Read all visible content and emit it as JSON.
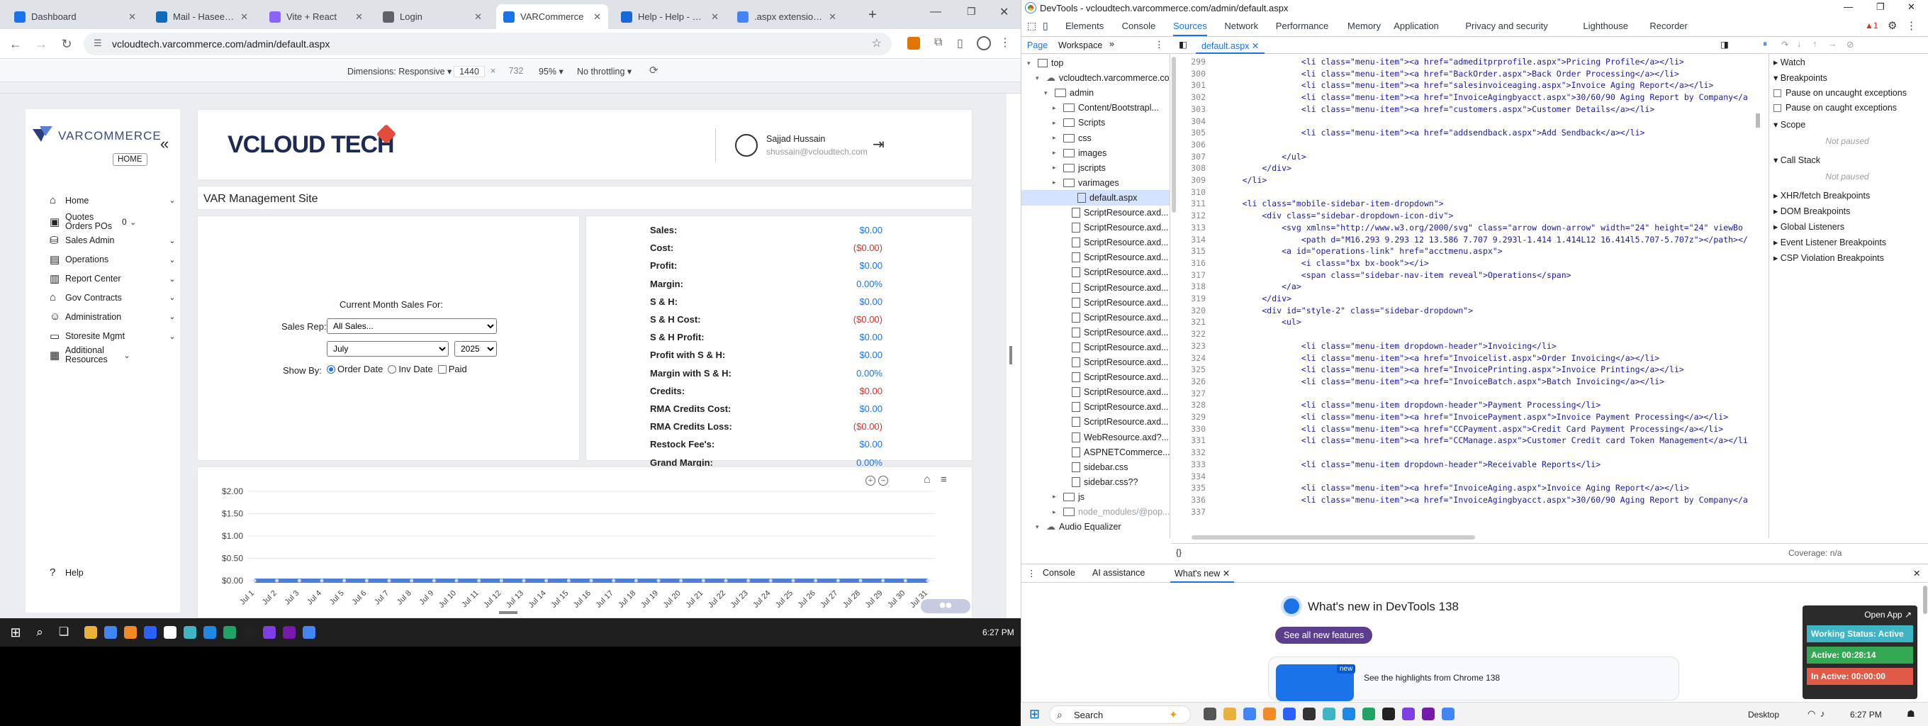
{
  "browser": {
    "tabs": [
      {
        "title": "Dashboard",
        "color": "#1a73e8"
      },
      {
        "title": "Mail - Haseeb Sha",
        "color": "#0f6cbd"
      },
      {
        "title": "Vite + React",
        "color": "#8a63ff"
      },
      {
        "title": "Login",
        "color": "#5f6368"
      },
      {
        "title": "VARCommerce",
        "color": "#1a73e8"
      },
      {
        "title": "Help - Help - Corr",
        "color": "#1868db"
      },
      {
        "title": ".aspx extension - G",
        "color": "#4285f4"
      }
    ],
    "url": "vcloudtech.varcommerce.com/admin/default.aspx",
    "device_toolbar": {
      "dimensions_label": "Dimensions: Responsive",
      "width": "1440",
      "height": "732",
      "zoom": "95%",
      "throttling": "No throttling"
    }
  },
  "site": {
    "home_button": "HOME",
    "user_name": "Sajjad Hussain",
    "user_email": "shussain@vcloudtech.com",
    "page_title": "VAR Management Site",
    "nav": [
      {
        "label": "Home",
        "icon": "home-icon",
        "glyph": "⌂"
      },
      {
        "label": "Quotes Orders POs",
        "icon": "quotes-icon",
        "glyph": "▣",
        "badge": "0"
      },
      {
        "label": "Sales Admin",
        "icon": "sales-admin-icon",
        "glyph": "⛁"
      },
      {
        "label": "Operations",
        "icon": "operations-icon",
        "glyph": "▤"
      },
      {
        "label": "Report Center",
        "icon": "report-center-icon",
        "glyph": "▥"
      },
      {
        "label": "Gov Contracts",
        "icon": "gov-contracts-icon",
        "glyph": "⌂"
      },
      {
        "label": "Administration",
        "icon": "administration-icon",
        "glyph": "☺"
      },
      {
        "label": "Storesite Mgmt",
        "icon": "storesite-icon",
        "glyph": "▭"
      },
      {
        "label": "Additional Resources",
        "icon": "resources-icon",
        "glyph": "▦"
      }
    ],
    "help_label": "Help",
    "filters": {
      "heading": "Current Month Sales For:",
      "sales_rep_label": "Sales Rep:",
      "sales_rep_value": "All Sales...",
      "month": "July",
      "year": "2025",
      "show_by_label": "Show By:",
      "opt_order_date": "Order Date",
      "opt_inv_date": "Inv Date",
      "opt_paid": "Paid"
    },
    "summary": [
      {
        "label": "Sales:",
        "value": "$0.00",
        "color": "#1a73e8"
      },
      {
        "label": "Cost:",
        "value": "($0.00)",
        "color": "#d93025"
      },
      {
        "label": "Profit:",
        "value": "$0.00",
        "color": "#1a73e8"
      },
      {
        "label": "Margin:",
        "value": "0.00%",
        "color": "#1a73e8"
      },
      {
        "label": "S & H:",
        "value": "$0.00",
        "color": "#1a73e8"
      },
      {
        "label": "S & H Cost:",
        "value": "($0.00)",
        "color": "#d93025"
      },
      {
        "label": "S & H Profit:",
        "value": "$0.00",
        "color": "#1a73e8"
      },
      {
        "label": "Profit with S & H:",
        "value": "$0.00",
        "color": "#1a73e8"
      },
      {
        "label": "Margin with S & H:",
        "value": "0.00%",
        "color": "#1a73e8"
      },
      {
        "label": "Credits:",
        "value": "$0.00",
        "color": "#d93025"
      },
      {
        "label": "RMA Credits Cost:",
        "value": "$0.00",
        "color": "#1a73e8"
      },
      {
        "label": "RMA Credits Loss:",
        "value": "($0.00)",
        "color": "#d93025"
      },
      {
        "label": "Restock Fee's:",
        "value": "$0.00",
        "color": "#1a73e8"
      },
      {
        "label": "Grand Margin:",
        "value": "0.00%",
        "color": "#1a73e8"
      },
      {
        "label": "Grand Profit:",
        "value": "$0.00",
        "color": "#188038"
      }
    ]
  },
  "chart_data": {
    "type": "line",
    "categories": [
      "Jul 1",
      "Jul 2",
      "Jul 3",
      "Jul 4",
      "Jul 5",
      "Jul 6",
      "Jul 7",
      "Jul 8",
      "Jul 9",
      "Jul 10",
      "Jul 11",
      "Jul 12",
      "Jul 13",
      "Jul 14",
      "Jul 15",
      "Jul 16",
      "Jul 17",
      "Jul 18",
      "Jul 19",
      "Jul 20",
      "Jul 21",
      "Jul 22",
      "Jul 23",
      "Jul 24",
      "Jul 25",
      "Jul 26",
      "Jul 27",
      "Jul 28",
      "Jul 29",
      "Jul 30",
      "Jul 31"
    ],
    "series": [
      {
        "values": [
          0,
          0,
          0,
          0,
          0,
          0,
          0,
          0,
          0,
          0,
          0,
          0,
          0,
          0,
          0,
          0,
          0,
          0,
          0,
          0,
          0,
          0,
          0,
          0,
          0,
          0,
          0,
          0,
          0,
          0,
          0
        ],
        "color": "#4e7fd6"
      }
    ],
    "y_ticks": [
      "$2.00",
      "$1.50",
      "$1.00",
      "$0.50",
      "$0.00"
    ],
    "ylim": [
      0,
      2
    ],
    "grid": true
  },
  "taskbar_left": {
    "time": "6:27 PM"
  },
  "devtools": {
    "title": "DevTools - vcloudtech.varcommerce.com/admin/default.aspx",
    "tabs": [
      "Elements",
      "Console",
      "Sources",
      "Network",
      "Performance",
      "Memory",
      "Application",
      "Privacy and security",
      "Lighthouse",
      "Recorder"
    ],
    "active_tab": "Sources",
    "issues_count": "1",
    "source_tabs": [
      "Page",
      "Workspace"
    ],
    "open_file": "default.aspx",
    "tree": [
      {
        "label": "top",
        "indent": 1,
        "type": "frame"
      },
      {
        "label": "vcloudtech.varcommerce.com",
        "indent": 2,
        "type": "cloud"
      },
      {
        "label": "admin",
        "indent": 3,
        "type": "folder"
      },
      {
        "label": "Content/Bootstrapl...",
        "indent": 4,
        "type": "folder"
      },
      {
        "label": "Scripts",
        "indent": 4,
        "type": "folder"
      },
      {
        "label": "css",
        "indent": 4,
        "type": "folder"
      },
      {
        "label": "images",
        "indent": 4,
        "type": "folder"
      },
      {
        "label": "jscripts",
        "indent": 4,
        "type": "folder"
      },
      {
        "label": "varimages",
        "indent": 4,
        "type": "folder"
      },
      {
        "label": "default.aspx",
        "indent": 4,
        "type": "file",
        "selected": true
      },
      {
        "label": "ScriptResource.axd...",
        "indent": 5,
        "type": "file"
      },
      {
        "label": "ScriptResource.axd...",
        "indent": 5,
        "type": "file"
      },
      {
        "label": "ScriptResource.axd...",
        "indent": 5,
        "type": "file"
      },
      {
        "label": "ScriptResource.axd...",
        "indent": 5,
        "type": "file"
      },
      {
        "label": "ScriptResource.axd...",
        "indent": 5,
        "type": "file"
      },
      {
        "label": "ScriptResource.axd...",
        "indent": 5,
        "type": "file"
      },
      {
        "label": "ScriptResource.axd...",
        "indent": 5,
        "type": "file"
      },
      {
        "label": "ScriptResource.axd...",
        "indent": 5,
        "type": "file"
      },
      {
        "label": "ScriptResource.axd...",
        "indent": 5,
        "type": "file"
      },
      {
        "label": "ScriptResource.axd...",
        "indent": 5,
        "type": "file"
      },
      {
        "label": "ScriptResource.axd...",
        "indent": 5,
        "type": "file"
      },
      {
        "label": "ScriptResource.axd...",
        "indent": 5,
        "type": "file"
      },
      {
        "label": "ScriptResource.axd...",
        "indent": 5,
        "type": "file"
      },
      {
        "label": "ScriptResource.axd...",
        "indent": 5,
        "type": "file"
      },
      {
        "label": "ScriptResource.axd...",
        "indent": 5,
        "type": "file"
      },
      {
        "label": "WebResource.axd?...",
        "indent": 5,
        "type": "file"
      },
      {
        "label": "ASPNETCommerce...",
        "indent": 5,
        "type": "file"
      },
      {
        "label": "sidebar.css",
        "indent": 5,
        "type": "file"
      },
      {
        "label": "sidebar.css??",
        "indent": 5,
        "type": "file"
      },
      {
        "label": "js",
        "indent": 4,
        "type": "folder"
      },
      {
        "label": "node_modules/@pop...",
        "indent": 4,
        "type": "folder"
      },
      {
        "label": "Audio Equalizer",
        "indent": 2,
        "type": "cloud"
      }
    ],
    "code_lines": [
      {
        "n": "299",
        "t": "                <li class=\"menu-item\"><a href=\"admeditprprofile.aspx\">Pricing Profile</a></li>"
      },
      {
        "n": "300",
        "t": "                <li class=\"menu-item\"><a href=\"BackOrder.aspx\">Back Order Processing</a></li>"
      },
      {
        "n": "301",
        "t": "                <li class=\"menu-item\"><a href=\"salesinvoiceaging.aspx\">Invoice Aging Report</a></li>"
      },
      {
        "n": "302",
        "t": "                <li class=\"menu-item\"><a href=\"InvoiceAgingbyacct.aspx\">30/60/90 Aging Report by Company</a"
      },
      {
        "n": "303",
        "t": "                <li class=\"menu-item\"><a href=\"customers.aspx\">Customer Details</a></li>"
      },
      {
        "n": "304",
        "t": ""
      },
      {
        "n": "305",
        "t": "                <li class=\"menu-item\"><a href=\"addsendback.aspx\">Add Sendback</a></li>"
      },
      {
        "n": "306",
        "t": ""
      },
      {
        "n": "307",
        "t": "            </ul>"
      },
      {
        "n": "308",
        "t": "        </div>"
      },
      {
        "n": "309",
        "t": "    </li>"
      },
      {
        "n": "310",
        "t": ""
      },
      {
        "n": "311",
        "t": "    <li class=\"mobile-sidebar-item-dropdown\">"
      },
      {
        "n": "312",
        "t": "        <div class=\"sidebar-dropdown-icon-div\">"
      },
      {
        "n": "313",
        "t": "            <svg xmlns=\"http://www.w3.org/2000/svg\" class=\"arrow down-arrow\" width=\"24\" height=\"24\" viewBo"
      },
      {
        "n": "314",
        "t": "                <path d=\"M16.293 9.293 12 13.586 7.707 9.293l-1.414 1.414L12 16.414l5.707-5.707z\"></path></"
      },
      {
        "n": "315",
        "t": "            <a id=\"operations-link\" href=\"acctmenu.aspx\">"
      },
      {
        "n": "316",
        "t": "                <i class=\"bx bx-book\"></i>"
      },
      {
        "n": "317",
        "t": "                <span class=\"sidebar-nav-item reveal\">Operations</span>"
      },
      {
        "n": "318",
        "t": "            </a>"
      },
      {
        "n": "319",
        "t": "        </div>"
      },
      {
        "n": "320",
        "t": "        <div id=\"style-2\" class=\"sidebar-dropdown\">"
      },
      {
        "n": "321",
        "t": "            <ul>"
      },
      {
        "n": "322",
        "t": ""
      },
      {
        "n": "323",
        "t": "                <li class=\"menu-item dropdown-header\">Invoicing</li>"
      },
      {
        "n": "324",
        "t": "                <li class=\"menu-item\"><a href=\"Invoicelist.aspx\">Order Invoicing</a></li>"
      },
      {
        "n": "325",
        "t": "                <li class=\"menu-item\"><a href=\"InvoicePrinting.aspx\">Invoice Printing</a></li>"
      },
      {
        "n": "326",
        "t": "                <li class=\"menu-item\"><a href=\"InvoiceBatch.aspx\">Batch Invoicing</a></li>"
      },
      {
        "n": "327",
        "t": ""
      },
      {
        "n": "328",
        "t": "                <li class=\"menu-item dropdown-header\">Payment Processing</li>"
      },
      {
        "n": "329",
        "t": "                <li class=\"menu-item\"><a href=\"InvoicePayment.aspx\">Invoice Payment Processing</a></li>"
      },
      {
        "n": "330",
        "t": "                <li class=\"menu-item\"><a href=\"CCPayment.aspx\">Credit Card Payment Processing</a></li>"
      },
      {
        "n": "331",
        "t": "                <li class=\"menu-item\"><a href=\"CCManage.aspx\">Customer Credit card Token Management</a></li"
      },
      {
        "n": "332",
        "t": ""
      },
      {
        "n": "333",
        "t": "                <li class=\"menu-item dropdown-header\">Receivable Reports</li>"
      },
      {
        "n": "334",
        "t": ""
      },
      {
        "n": "335",
        "t": "                <li class=\"menu-item\"><a href=\"InvoiceAging.aspx\">Invoice Aging Report</a></li>"
      },
      {
        "n": "336",
        "t": "                <li class=\"menu-item\"><a href=\"InvoiceAgingbyacct.aspx\">30/60/90 Aging Report by Company</a"
      },
      {
        "n": "337",
        "t": ""
      }
    ],
    "right_pane": {
      "watch": "Watch",
      "breakpoints": "Breakpoints",
      "pause_uncaught": "Pause on uncaught exceptions",
      "pause_caught": "Pause on caught exceptions",
      "scope": "Scope",
      "not_paused": "Not paused",
      "call_stack": "Call Stack",
      "xhr": "XHR/fetch Breakpoints",
      "dom": "DOM Breakpoints",
      "global": "Global Listeners",
      "event": "Event Listener Breakpoints",
      "csp": "CSP Violation Breakpoints"
    },
    "coverage": "Coverage: n/a",
    "drawer_tabs": [
      "Console",
      "AI assistance",
      "What's new"
    ],
    "whats_new_title": "What's new in DevTools 138",
    "see_all": "See all new features",
    "highlights": "See the highlights from Chrome 138",
    "new_badge": "new",
    "open_app": "Open App",
    "working_status": "Working Status: Active",
    "active_time": "Active: 00:28:14",
    "inactive_time": "In Active: 00:00:00"
  },
  "taskbar_right": {
    "search": "Search",
    "desktop": "Desktop",
    "time": "6:27 PM"
  }
}
